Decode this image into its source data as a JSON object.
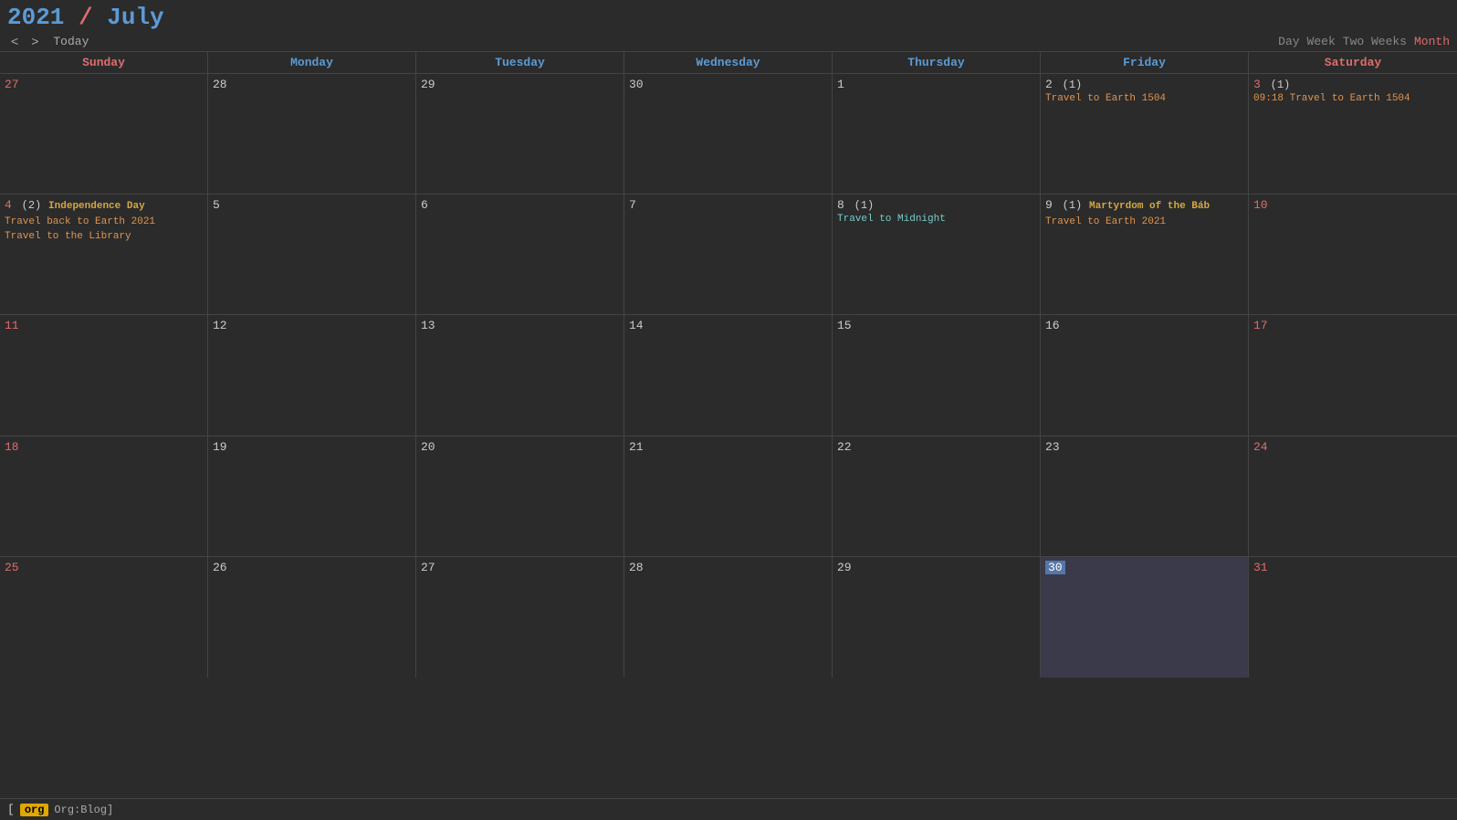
{
  "header": {
    "year": "2021",
    "slash": "/",
    "month": "July",
    "prev_label": "<",
    "next_label": ">",
    "today_label": "Today",
    "views": [
      {
        "id": "day",
        "label": "Day",
        "active": false
      },
      {
        "id": "week",
        "label": "Week",
        "active": false
      },
      {
        "id": "two-weeks",
        "label": "Two Weeks",
        "active": false
      },
      {
        "id": "month",
        "label": "Month",
        "active": true
      }
    ]
  },
  "day_headers": [
    {
      "label": "Sunday",
      "type": "weekend"
    },
    {
      "label": "Monday",
      "type": "weekday"
    },
    {
      "label": "Tuesday",
      "type": "weekday"
    },
    {
      "label": "Wednesday",
      "type": "weekday"
    },
    {
      "label": "Thursday",
      "type": "weekday"
    },
    {
      "label": "Friday",
      "type": "weekday"
    },
    {
      "label": "Saturday",
      "type": "weekend"
    }
  ],
  "weeks": [
    {
      "days": [
        {
          "num": "27",
          "type": "other-month weekend",
          "events": []
        },
        {
          "num": "28",
          "type": "other-month weekday",
          "events": []
        },
        {
          "num": "29",
          "type": "other-month weekday",
          "events": []
        },
        {
          "num": "30",
          "type": "other-month weekday",
          "events": []
        },
        {
          "num": "1",
          "type": "weekday",
          "events": []
        },
        {
          "num": "2",
          "type": "weekday",
          "count": "(1)",
          "events": [
            {
              "text": "Travel to Earth 1504",
              "class": "orange"
            }
          ]
        },
        {
          "num": "3",
          "type": "weekend",
          "count": "(1)",
          "events": [
            {
              "text": "09:18 Travel to Earth 1504",
              "class": "time"
            }
          ]
        }
      ]
    },
    {
      "days": [
        {
          "num": "4",
          "type": "weekend",
          "count": "(2)",
          "events": [
            {
              "text": "Independence Day",
              "class": "holiday"
            },
            {
              "text": "Travel back to Earth 2021",
              "class": "orange"
            },
            {
              "text": "Travel to the Library",
              "class": "orange"
            }
          ]
        },
        {
          "num": "5",
          "type": "weekday",
          "events": []
        },
        {
          "num": "6",
          "type": "weekday",
          "events": []
        },
        {
          "num": "7",
          "type": "weekday",
          "events": []
        },
        {
          "num": "8",
          "type": "weekday",
          "count": "(1)",
          "events": [
            {
              "text": "Travel to Midnight",
              "class": "cyan"
            }
          ]
        },
        {
          "num": "9",
          "type": "weekday",
          "count": "(1)",
          "events": [
            {
              "text": "Martyrdom of the Báb",
              "class": "holiday"
            },
            {
              "text": "Travel to Earth 2021",
              "class": "orange"
            }
          ]
        },
        {
          "num": "10",
          "type": "weekend",
          "events": []
        }
      ]
    },
    {
      "days": [
        {
          "num": "11",
          "type": "weekend",
          "events": []
        },
        {
          "num": "12",
          "type": "weekday",
          "events": []
        },
        {
          "num": "13",
          "type": "weekday",
          "events": []
        },
        {
          "num": "14",
          "type": "weekday",
          "events": []
        },
        {
          "num": "15",
          "type": "weekday",
          "events": []
        },
        {
          "num": "16",
          "type": "weekday",
          "events": []
        },
        {
          "num": "17",
          "type": "weekend",
          "events": []
        }
      ]
    },
    {
      "days": [
        {
          "num": "18",
          "type": "weekend",
          "events": []
        },
        {
          "num": "19",
          "type": "weekday",
          "events": []
        },
        {
          "num": "20",
          "type": "weekday",
          "events": []
        },
        {
          "num": "21",
          "type": "weekday",
          "events": []
        },
        {
          "num": "22",
          "type": "weekday",
          "events": []
        },
        {
          "num": "23",
          "type": "weekday",
          "events": []
        },
        {
          "num": "24",
          "type": "weekend",
          "events": []
        }
      ]
    },
    {
      "days": [
        {
          "num": "25",
          "type": "weekend",
          "events": []
        },
        {
          "num": "26",
          "type": "weekday",
          "events": []
        },
        {
          "num": "27",
          "type": "weekday",
          "events": []
        },
        {
          "num": "28",
          "type": "weekday",
          "events": []
        },
        {
          "num": "29",
          "type": "weekday",
          "events": []
        },
        {
          "num": "30",
          "type": "weekday today",
          "events": []
        },
        {
          "num": "31",
          "type": "weekend",
          "events": []
        }
      ]
    }
  ],
  "footer": {
    "tag": "org",
    "label": "Org:Blog]"
  },
  "colors": {
    "bg": "#2b2b2b",
    "weekend_header": "#e06c6c",
    "weekday_header": "#5b9bd5",
    "title_blue": "#5b9bd5",
    "title_red": "#e06c6c",
    "border": "#444",
    "event_orange": "#e0944e",
    "event_cyan": "#7cc",
    "event_holiday": "#d4a843",
    "today_bg": "#5577aa"
  }
}
